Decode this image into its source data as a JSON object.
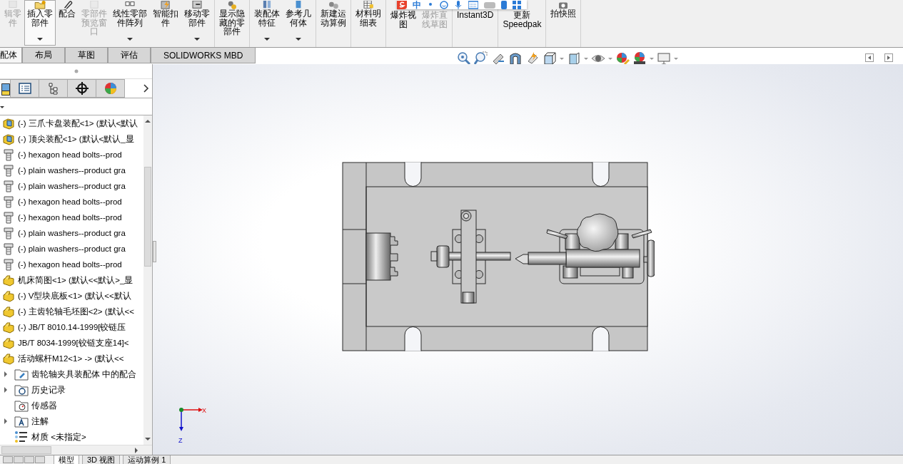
{
  "toolbar": {
    "groups": [
      [
        {
          "kind": "edit",
          "lines": [
            "辑零",
            "件"
          ],
          "disabled": true,
          "selected": false,
          "dropdown": false
        },
        {
          "kind": "insert",
          "lines": [
            "插入零",
            "部件"
          ],
          "disabled": false,
          "selected": true,
          "dropdown": true
        },
        {
          "kind": "mate",
          "lines": [
            "配合"
          ],
          "disabled": false,
          "selected": false,
          "dropdown": false
        },
        {
          "kind": "preview",
          "lines": [
            "零部件",
            "预览窗",
            "口"
          ],
          "disabled": true,
          "selected": false,
          "dropdown": false
        },
        {
          "kind": "pattern",
          "lines": [
            "线性零部",
            "件阵列"
          ],
          "disabled": false,
          "selected": false,
          "dropdown": true
        },
        {
          "kind": "fastener",
          "lines": [
            "智能扣",
            "件"
          ],
          "disabled": false,
          "selected": false,
          "dropdown": false
        },
        {
          "kind": "move",
          "lines": [
            "移动零",
            "部件"
          ],
          "disabled": false,
          "selected": false,
          "dropdown": true
        }
      ],
      [
        {
          "kind": "show-hidden",
          "lines": [
            "显示隐",
            "藏的零",
            "部件"
          ],
          "disabled": false,
          "selected": false,
          "dropdown": false
        }
      ],
      [
        {
          "kind": "feature",
          "lines": [
            "装配体",
            "特征"
          ],
          "disabled": false,
          "selected": false,
          "dropdown": true
        },
        {
          "kind": "reference",
          "lines": [
            "参考几",
            "何体"
          ],
          "disabled": false,
          "selected": false,
          "dropdown": true
        }
      ],
      [
        {
          "kind": "motion",
          "lines": [
            "新建运",
            "动算例"
          ],
          "disabled": false,
          "selected": false,
          "dropdown": false
        }
      ],
      [
        {
          "kind": "bom",
          "lines": [
            "材料明",
            "细表"
          ],
          "disabled": false,
          "selected": false,
          "dropdown": false
        }
      ],
      [
        {
          "kind": "explode",
          "lines": [
            "爆炸视",
            "图"
          ],
          "disabled": false,
          "selected": false,
          "dropdown": false
        },
        {
          "kind": "explode-sketch",
          "lines": [
            "爆炸直",
            "线草图"
          ],
          "disabled": true,
          "selected": false,
          "dropdown": false
        }
      ],
      [
        {
          "kind": "instant3d",
          "lines": [
            "Instant3D"
          ],
          "disabled": false,
          "selected": false,
          "dropdown": false
        }
      ],
      [
        {
          "kind": "speedpak",
          "lines": [
            "更新",
            "Speedpak"
          ],
          "disabled": false,
          "selected": false,
          "dropdown": false
        }
      ],
      [
        {
          "kind": "snapshot",
          "lines": [
            "拍快照"
          ],
          "disabled": false,
          "selected": false,
          "dropdown": false
        }
      ]
    ]
  },
  "ime_bar": {
    "mode": "中"
  },
  "tabs": [
    {
      "label": "配体",
      "selected": true
    },
    {
      "label": "布局",
      "selected": false
    },
    {
      "label": "草图",
      "selected": false
    },
    {
      "label": "评估",
      "selected": false
    },
    {
      "label": "SOLIDWORKS MBD",
      "selected": false
    }
  ],
  "view_toolbar": [
    {
      "kind": "zoom-fit",
      "dropdown": false
    },
    {
      "kind": "zoom-area",
      "dropdown": false
    },
    {
      "kind": "previous-view",
      "dropdown": false
    },
    {
      "kind": "section-view",
      "dropdown": false
    },
    {
      "kind": "dynamic-annotation",
      "dropdown": false
    },
    {
      "kind": "view-orientation",
      "dropdown": true
    },
    {
      "kind": "display-style",
      "dropdown": true
    },
    {
      "kind": "hide-show",
      "dropdown": true
    },
    {
      "kind": "edit-appearance",
      "dropdown": false
    },
    {
      "kind": "apply-scene",
      "dropdown": true
    },
    {
      "kind": "view-settings",
      "dropdown": true
    }
  ],
  "panel_tabs": [
    {
      "kind": "feature-tree",
      "selected": true
    },
    {
      "kind": "property",
      "selected": false
    },
    {
      "kind": "configuration",
      "selected": false
    },
    {
      "kind": "dimension",
      "selected": false
    },
    {
      "kind": "display",
      "selected": false
    }
  ],
  "components": [
    {
      "kind": "assembly",
      "text": "(-) 三爪卡盘装配<1> (默认<默认"
    },
    {
      "kind": "assembly",
      "text": "(-) 顶尖装配<1> (默认<默认_显"
    },
    {
      "kind": "bolt",
      "text": "(-) hexagon head bolts--prod"
    },
    {
      "kind": "bolt",
      "text": "(-) plain washers--product gra"
    },
    {
      "kind": "bolt",
      "text": "(-) plain washers--product gra"
    },
    {
      "kind": "bolt",
      "text": "(-) hexagon head bolts--prod"
    },
    {
      "kind": "bolt",
      "text": "(-) hexagon head bolts--prod"
    },
    {
      "kind": "bolt",
      "text": "(-) plain washers--product gra"
    },
    {
      "kind": "bolt",
      "text": "(-) plain washers--product gra"
    },
    {
      "kind": "bolt",
      "text": "(-) hexagon head bolts--prod"
    },
    {
      "kind": "part",
      "text": "机床简图<1> (默认<<默认>_显"
    },
    {
      "kind": "part",
      "text": "(-) V型块底板<1> (默认<<默认"
    },
    {
      "kind": "part",
      "text": "(-) 主齿轮轴毛坯图<2> (默认<<"
    },
    {
      "kind": "part",
      "text": "(-) JB/T 8010.14-1999[铰链压"
    },
    {
      "kind": "part",
      "text": "JB/T 8034-1999[铰链支座14]<"
    },
    {
      "kind": "part",
      "text": "活动螺杆M12<1> -> (默认<<"
    }
  ],
  "folders": [
    {
      "kind": "mates",
      "text": "齿轮轴夹具装配体 中的配合",
      "expandable": true
    },
    {
      "kind": "history",
      "text": "历史记录",
      "expandable": true
    },
    {
      "kind": "sensors",
      "text": "传感器",
      "expandable": false
    },
    {
      "kind": "annotations",
      "text": "注解",
      "expandable": true
    },
    {
      "kind": "material",
      "text": "材质 <未指定>",
      "expandable": false
    }
  ],
  "bottom_tabs": [
    {
      "label": "模型",
      "selected": true
    },
    {
      "label": "3D 视图",
      "selected": false
    },
    {
      "label": "运动算例 1",
      "selected": false
    }
  ],
  "triad": {
    "x_label": "X",
    "z_label": "Z"
  }
}
